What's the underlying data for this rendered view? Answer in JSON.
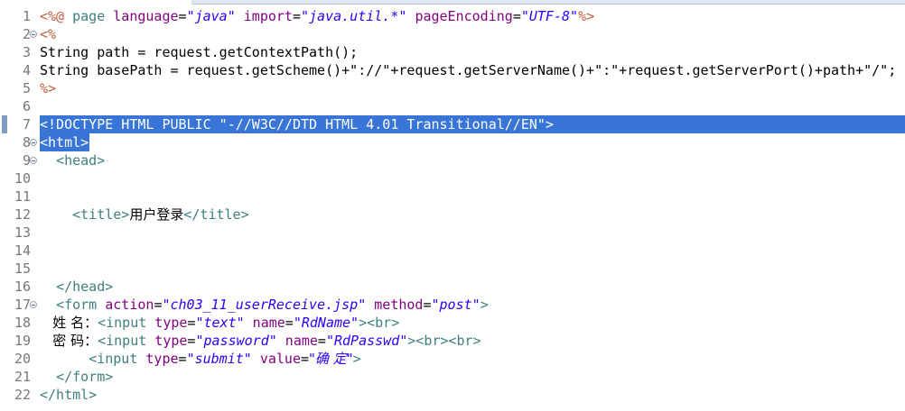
{
  "editor": {
    "lines": [
      {
        "num": "1",
        "tokens": [
          [
            "t-dir",
            "<%@"
          ],
          [
            "t-plain",
            " "
          ],
          [
            "t-kw",
            "page"
          ],
          [
            "t-plain",
            " "
          ],
          [
            "t-attr",
            "language"
          ],
          [
            "t-plain",
            "="
          ],
          [
            "t-str",
            "\"java\""
          ],
          [
            "t-plain",
            " "
          ],
          [
            "t-attr",
            "import"
          ],
          [
            "t-plain",
            "="
          ],
          [
            "t-str",
            "\"java.util.*\""
          ],
          [
            "t-plain",
            " "
          ],
          [
            "t-attr",
            "pageEncoding"
          ],
          [
            "t-plain",
            "="
          ],
          [
            "t-str",
            "\"UTF-8\""
          ],
          [
            "t-dir",
            "%>"
          ]
        ]
      },
      {
        "num": "2",
        "fold": true,
        "tokens": [
          [
            "t-dir",
            "<%"
          ]
        ]
      },
      {
        "num": "3",
        "tokens": [
          [
            "t-plain",
            "String path = request.getContextPath();"
          ]
        ]
      },
      {
        "num": "4",
        "tokens": [
          [
            "t-plain",
            "String basePath = request.getScheme()+\"://\"+request.getServerName()+\":\"+request.getServerPort()+path+\"/\";"
          ]
        ]
      },
      {
        "num": "5",
        "tokens": [
          [
            "t-dir",
            "%>"
          ]
        ]
      },
      {
        "num": "6",
        "tokens": []
      },
      {
        "num": "7",
        "marker": true,
        "selected": "full",
        "tokens": [
          [
            "t-tag",
            "<!DOCTYPE HTML PUBLIC \"-//W3C//DTD HTML 4.01 Transitional//EN\">"
          ]
        ]
      },
      {
        "num": "8",
        "fold": true,
        "selected": "part",
        "tokens": [
          [
            "t-tag",
            "<html>"
          ]
        ]
      },
      {
        "num": "9",
        "fold": true,
        "tokens": [
          [
            "t-plain",
            "  "
          ],
          [
            "t-tag",
            "<head>"
          ]
        ]
      },
      {
        "num": "10",
        "tokens": []
      },
      {
        "num": "11",
        "tokens": []
      },
      {
        "num": "12",
        "tokens": [
          [
            "t-plain",
            "    "
          ],
          [
            "t-tag",
            "<title>"
          ],
          [
            "t-plain t-cjk",
            "用户登录"
          ],
          [
            "t-tag",
            "</title>"
          ]
        ]
      },
      {
        "num": "13",
        "tokens": []
      },
      {
        "num": "14",
        "tokens": []
      },
      {
        "num": "15",
        "tokens": []
      },
      {
        "num": "16",
        "tokens": [
          [
            "t-plain",
            "  "
          ],
          [
            "t-tag",
            "</head>"
          ]
        ]
      },
      {
        "num": "17",
        "fold": true,
        "tokens": [
          [
            "t-plain",
            "  "
          ],
          [
            "t-tag",
            "<form"
          ],
          [
            "t-plain",
            " "
          ],
          [
            "t-attr",
            "action"
          ],
          [
            "t-plain",
            "="
          ],
          [
            "t-str",
            "\"ch03_11_userReceive.jsp\""
          ],
          [
            "t-plain",
            " "
          ],
          [
            "t-attr",
            "method"
          ],
          [
            "t-plain",
            "="
          ],
          [
            "t-str",
            "\"post\""
          ],
          [
            "t-tag",
            ">"
          ]
        ]
      },
      {
        "num": "18",
        "tokens": [
          [
            "t-plain t-cjk",
            "   姓 名："
          ],
          [
            "t-tag",
            "<input"
          ],
          [
            "t-plain",
            " "
          ],
          [
            "t-attr",
            "type"
          ],
          [
            "t-plain",
            "="
          ],
          [
            "t-str",
            "\"text\""
          ],
          [
            "t-plain",
            " "
          ],
          [
            "t-attr",
            "name"
          ],
          [
            "t-plain",
            "="
          ],
          [
            "t-str",
            "\"RdName\""
          ],
          [
            "t-tag",
            ">"
          ],
          [
            "t-tag",
            "<br>"
          ]
        ]
      },
      {
        "num": "19",
        "tokens": [
          [
            "t-plain t-cjk",
            "   密 码："
          ],
          [
            "t-tag",
            "<input"
          ],
          [
            "t-plain",
            " "
          ],
          [
            "t-attr",
            "type"
          ],
          [
            "t-plain",
            "="
          ],
          [
            "t-str",
            "\"password\""
          ],
          [
            "t-plain",
            " "
          ],
          [
            "t-attr",
            "name"
          ],
          [
            "t-plain",
            "="
          ],
          [
            "t-str",
            "\"RdPasswd\""
          ],
          [
            "t-tag",
            ">"
          ],
          [
            "t-tag",
            "<br>"
          ],
          [
            "t-tag",
            "<br>"
          ]
        ]
      },
      {
        "num": "20",
        "tokens": [
          [
            "t-plain",
            "      "
          ],
          [
            "t-tag",
            "<input"
          ],
          [
            "t-plain",
            " "
          ],
          [
            "t-attr",
            "type"
          ],
          [
            "t-plain",
            "="
          ],
          [
            "t-str",
            "\"submit\""
          ],
          [
            "t-plain",
            " "
          ],
          [
            "t-attr",
            "value"
          ],
          [
            "t-plain",
            "="
          ],
          [
            "t-str t-cjk",
            "\"确 定\""
          ],
          [
            "t-tag",
            ">"
          ]
        ]
      },
      {
        "num": "21",
        "tokens": [
          [
            "t-plain",
            "  "
          ],
          [
            "t-tag",
            "</form>"
          ]
        ]
      },
      {
        "num": "22",
        "tokens": [
          [
            "t-tag",
            "</html>"
          ]
        ]
      }
    ]
  }
}
